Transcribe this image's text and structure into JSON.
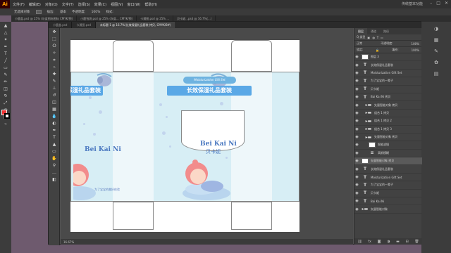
{
  "illustrator": {
    "logo": "Ai",
    "menu": [
      "文件(F)",
      "编辑(E)",
      "对象(O)",
      "文字(T)",
      "选择(S)",
      "效果(C)",
      "视图(V)",
      "窗口(W)",
      "帮助(H)"
    ],
    "workspace": "传统基本功能",
    "tabs": [
      "小鹿盖.psd @ 25% (灰度图标图标 CMYK/预)",
      "小鹿钱袋.psd @ 25% (灰度... CMYK/预)",
      "卡通图.psd @ 25% ...",
      "贝卡妮...psd @ 16.7%(...)"
    ],
    "control_bar": [
      "无选择对象",
      "描边:",
      "基本",
      "不透明度:",
      "100%",
      "样式:"
    ]
  },
  "photoshop": {
    "document_tab": "未标题-1 @ 16.7%(长效保湿礼品套装 拷贝, CMYK/8#)",
    "inactive_tabs": [
      "小鹿盖.psd",
      "卡通图.psd"
    ],
    "status": "16.67%",
    "panel_tabs": [
      "图层",
      "通道",
      "路径"
    ],
    "filter_label": "Q 类型",
    "blend_mode": "正常",
    "opacity_label": "不透明度:",
    "opacity": "100%",
    "lock_label": "锁定:",
    "fill_label": "填充:",
    "fill": "100%",
    "layers": [
      {
        "name": "图层 3",
        "kind": "image",
        "indent": 0,
        "visible": true
      },
      {
        "name": "长效保湿礼品套装",
        "kind": "text",
        "indent": 0,
        "visible": true
      },
      {
        "name": "Moisturization Gift Set",
        "kind": "text",
        "indent": 0,
        "visible": true
      },
      {
        "name": "为了宝宝的一辈子",
        "kind": "text",
        "indent": 0,
        "visible": true
      },
      {
        "name": "贝卡妮",
        "kind": "text",
        "indent": 0,
        "visible": true
      },
      {
        "name": "Bai Kai Ni 拷贝",
        "kind": "text",
        "indent": 0,
        "visible": true
      },
      {
        "name": "矢量智能对象 拷贝",
        "kind": "group",
        "indent": 1,
        "visible": true
      },
      {
        "name": "组合 1 拷贝",
        "kind": "group",
        "indent": 1,
        "visible": true
      },
      {
        "name": "组合 1 拷贝 2",
        "kind": "group",
        "indent": 1,
        "visible": true
      },
      {
        "name": "组合 1 拷贝 3",
        "kind": "group",
        "indent": 1,
        "visible": true
      },
      {
        "name": "矢量智能对象 拷贝",
        "kind": "group",
        "indent": 1,
        "visible": true
      },
      {
        "name": "智能滤镜",
        "kind": "image",
        "indent": 2,
        "visible": true
      },
      {
        "name": "高斯模糊",
        "kind": "fx",
        "indent": 2,
        "visible": true
      },
      {
        "name": "矢量智能对象 拷贝",
        "kind": "image",
        "indent": 0,
        "visible": true,
        "selected": true
      },
      {
        "name": "长效保湿礼品套装",
        "kind": "text",
        "indent": 0,
        "visible": true
      },
      {
        "name": "Moisturization Gift Set",
        "kind": "text",
        "indent": 0,
        "visible": true
      },
      {
        "name": "为了宝宝的一辈子",
        "kind": "text",
        "indent": 0,
        "visible": true
      },
      {
        "name": "贝卡妮",
        "kind": "text",
        "indent": 0,
        "visible": true
      },
      {
        "name": "Bai Kai Ni",
        "kind": "text",
        "indent": 0,
        "visible": true
      },
      {
        "name": "矢量智能对象",
        "kind": "group",
        "indent": 0,
        "visible": true
      }
    ],
    "footer_icons": [
      "link-icon",
      "fx-icon",
      "mask-icon",
      "adjustment-icon",
      "folder-icon",
      "new-layer-icon",
      "trash-icon"
    ]
  },
  "artwork": {
    "subtitle": "Moisturization Gift Set",
    "title": "长效保湿礼品套装",
    "brand_en": "Bei Kai Ni",
    "brand_cn": "贝卡妮",
    "tagline": "为了宝宝的美好体验"
  },
  "colors": {
    "panel_bg": "#d7eef5",
    "title_bar": "#5aa8e6",
    "brand": "#4a78c0"
  }
}
